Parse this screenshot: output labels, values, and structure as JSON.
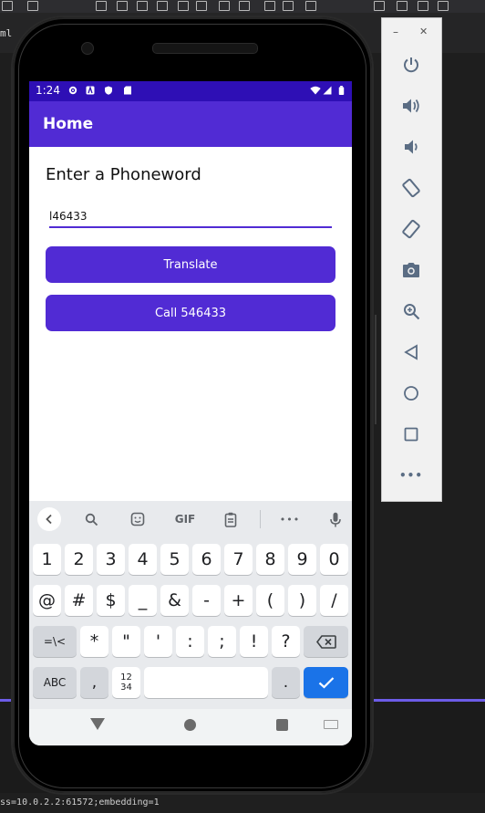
{
  "ide": {
    "tab_label": "ml",
    "status_text": "ss=10.0.2.2:61572;embedding=1"
  },
  "status_bar": {
    "time": "1:24"
  },
  "app_bar": {
    "title": "Home"
  },
  "content": {
    "heading": "Enter a Phoneword",
    "entry_value": "l46433",
    "translate_label": "Translate",
    "call_label": "Call 546433"
  },
  "keyboard": {
    "toolbar_gif": "GIF",
    "toolbar_more": "•••",
    "row1": [
      "1",
      "2",
      "3",
      "4",
      "5",
      "6",
      "7",
      "8",
      "9",
      "0"
    ],
    "row2": [
      "@",
      "#",
      "$",
      "_",
      "&",
      "-",
      "+",
      "(",
      ")",
      "/"
    ],
    "row3_mod": "=\\<",
    "row3": [
      "*",
      "\"",
      "'",
      ":",
      ";",
      "!",
      "?"
    ],
    "row4_abc": "ABC",
    "row4_comma": ",",
    "row4_num": "12\n34",
    "row4_dot": "."
  },
  "emulator_panel": {
    "minimize": "–",
    "close": "✕",
    "more": "•••"
  },
  "colors": {
    "status_bar": "#2e0fb5",
    "app_bar": "#512bd4",
    "button": "#512bd4",
    "enter_key": "#1a73e8"
  },
  "icons": {
    "panel": [
      "power-icon",
      "volume-up-icon",
      "volume-down-icon",
      "rotate-left-icon",
      "rotate-right-icon",
      "camera-icon",
      "zoom-icon",
      "back-icon",
      "home-icon",
      "overview-icon",
      "more-icon"
    ]
  }
}
